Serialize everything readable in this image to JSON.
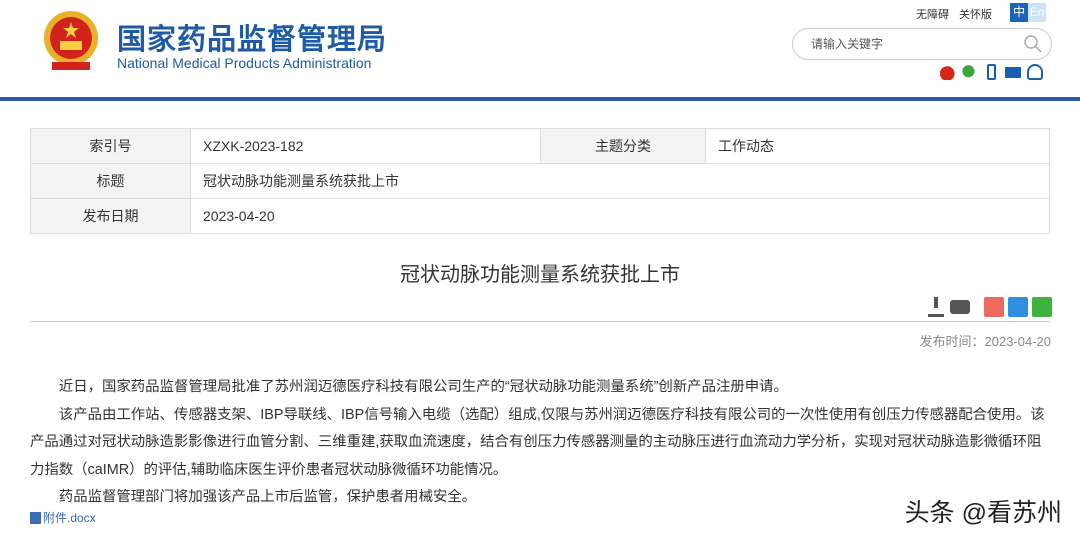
{
  "header": {
    "title": "国家药品监督管理局",
    "subtitle": "National Medical Products Administration",
    "links": [
      "无障碍",
      "关怀版"
    ],
    "lang": [
      "中",
      "En"
    ],
    "search_placeholder": "请输入关键字"
  },
  "meta_table": {
    "rows": [
      {
        "label": "索引号",
        "value": "XZXK-2023-182",
        "label2": "主题分类",
        "value2": "工作动态"
      },
      {
        "label": "标题",
        "value": "冠状动脉功能测量系统获批上市"
      },
      {
        "label": "发布日期",
        "value": "2023-04-20"
      }
    ]
  },
  "article": {
    "title": "冠状动脉功能测量系统获批上市",
    "pub_time": "发布时间：2023-04-20",
    "paragraphs": [
      "近日，国家药品监督管理局批准了苏州润迈德医疗科技有限公司生产的“冠状动脉功能测量系统”创新产品注册申请。",
      "该产品由工作站、传感器支架、IBP导联线、IBP信号输入电缆（选配）组成,仅限与苏州润迈德医疗科技有限公司的一次性使用有创压力传感器配合使用。该产品通过对冠状动脉造影影像进行血管分割、三维重建,获取血流速度，结合有创压力传感器测量的主动脉压进行血流动力学分析，实现对冠状动脉造影微循环阻力指数（caIMR）的评估,辅助临床医生评价患者冠状动脉微循环功能情况。",
      "药品监督管理部门将加强该产品上市后监管，保护患者用械安全。"
    ],
    "attachment": "附件.docx"
  },
  "watermark": "头条 @看苏州"
}
